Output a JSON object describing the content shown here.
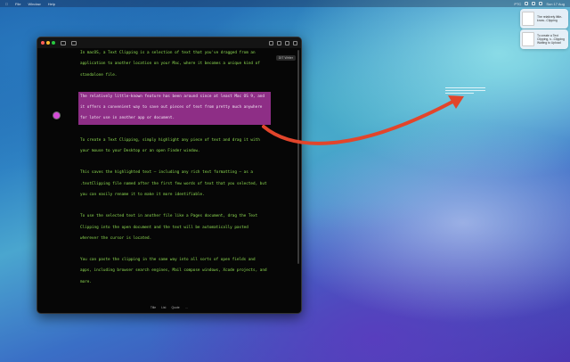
{
  "menubar": {
    "items": [
      "File",
      "Window",
      "Help"
    ],
    "status": [
      "PTC",
      "Sun 17 Aug"
    ]
  },
  "notifications": [
    {
      "text": "The relatively little-know...Clipping"
    },
    {
      "text": "To create a Text Clipping, s...Clipping Waiting to Upload"
    }
  ],
  "window": {
    "editor_label": "DIT Writer",
    "paragraphs": [
      "In macOS, a Text Clipping is a selection of text that you've dragged from an application to another location on your Mac, where it becomes a unique kind of standalone file.",
      "The relatively little-known feature has been around since at least Mac OS 9, and it offers a convenient way to save out pieces of text from pretty much anywhere for later use in another app or document.",
      "To create a Text Clipping, simply highlight any piece of text and drag it with your mouse to your Desktop or an open Finder window.",
      "This saves the highlighted text – including any rich text formatting – as a .textClipping file named after the first few words of text that you selected, but you can easily rename it to make it more identifiable.",
      "To use the selected text in another file like a Pages document, drag the Text Clipping into the open document and the text will be automatically pasted wherever the cursor is located.",
      "You can paste the clipping in the same way into all sorts of open fields and apps, including browser search engines, Mail compose windows, Xcode projects, and more."
    ],
    "selected_paragraph_index": 1,
    "status_bar": [
      "Title",
      "List",
      "Quote",
      "…"
    ]
  },
  "colors": {
    "text": "#8fdc52",
    "selection": "#8e2e86",
    "arrow": "#e2452b"
  }
}
